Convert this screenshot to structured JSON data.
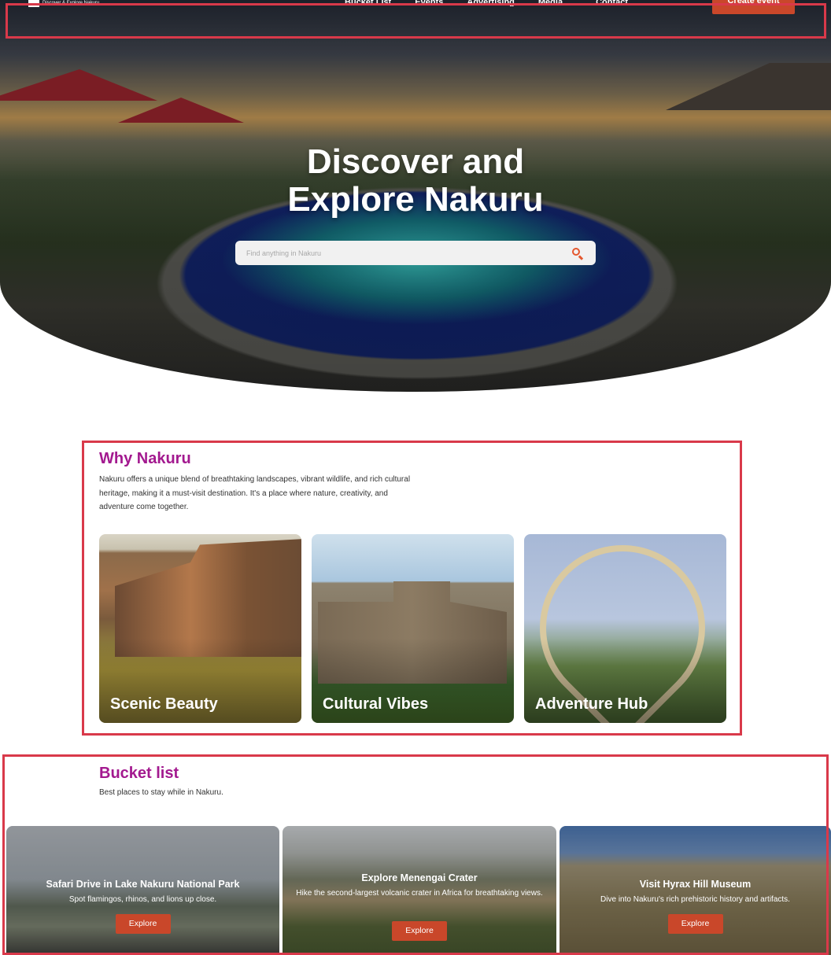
{
  "nav": {
    "logo_tagline": "Discover & Explore Nakuru",
    "links": [
      "Bucket List",
      "Events",
      "Advertising",
      "Media",
      "Contact"
    ],
    "cta": "Create event"
  },
  "hero": {
    "title_line1": "Discover and",
    "title_line2": "Explore Nakuru",
    "search_placeholder": "Find anything in Nakuru",
    "search_icon": "search-icon"
  },
  "why": {
    "title": "Why Nakuru",
    "description": "Nakuru offers a unique blend of breathtaking landscapes, vibrant wildlife, and rich cultural heritage, making it a must-visit destination. It's a place where nature, creativity, and adventure come together.",
    "cards": [
      {
        "label": "Scenic Beauty"
      },
      {
        "label": "Cultural Vibes"
      },
      {
        "label": "Adventure Hub"
      }
    ]
  },
  "bucket": {
    "title": "Bucket list",
    "description": "Best places to stay while in Nakuru.",
    "items": [
      {
        "title": "Safari Drive in Lake Nakuru National Park",
        "description": "Spot flamingos, rhinos, and lions up close.",
        "button": "Explore"
      },
      {
        "title": "Explore Menengai Crater",
        "description": "Hike the second-largest volcanic crater in Africa for breathtaking views.",
        "button": "Explore"
      },
      {
        "title": "Visit Hyrax Hill Museum",
        "description": "Dive into Nakuru's rich prehistoric history and artifacts.",
        "button": "Explore"
      }
    ]
  },
  "colors": {
    "accent": "#c9472a",
    "heading": "#a3198f",
    "search_icon": "#e4572e"
  }
}
